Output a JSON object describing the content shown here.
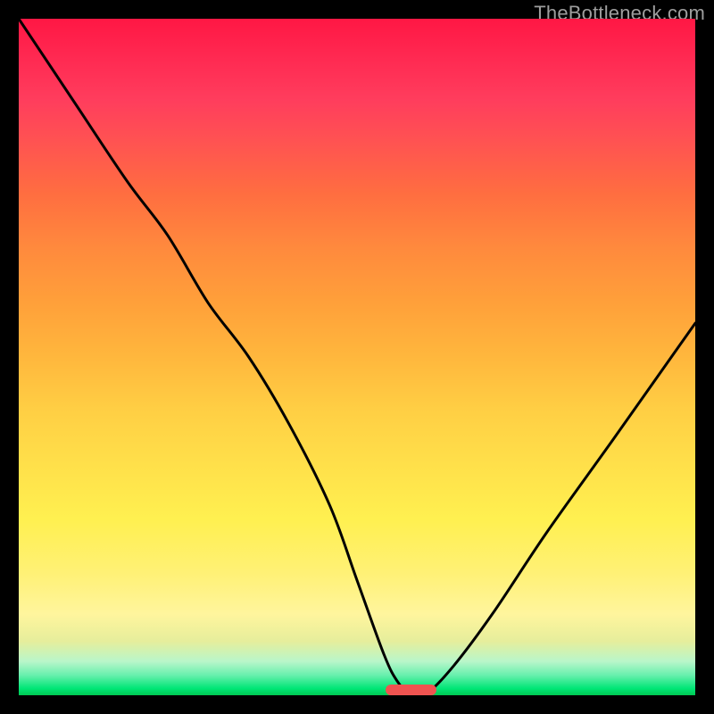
{
  "watermark": "TheBottleneck.com",
  "chart_data": {
    "type": "line",
    "title": "",
    "xlabel": "",
    "ylabel": "",
    "xlim": [
      0,
      100
    ],
    "ylim": [
      0,
      100
    ],
    "grid": false,
    "series": [
      {
        "name": "bottleneck-curve",
        "color": "#000000",
        "x": [
          0,
          8,
          16,
          22,
          28,
          34,
          40,
          46,
          50,
          54,
          56,
          58,
          60,
          64,
          70,
          78,
          88,
          100
        ],
        "values": [
          100,
          88,
          76,
          68,
          58,
          50,
          40,
          28,
          17,
          6,
          2,
          0,
          0,
          4,
          12,
          24,
          38,
          55
        ]
      }
    ],
    "gradient_stops": [
      {
        "pos": 0,
        "color": "#ff1744"
      },
      {
        "pos": 50,
        "color": "#ffb73d"
      },
      {
        "pos": 82,
        "color": "#fff176"
      },
      {
        "pos": 99,
        "color": "#00e676"
      },
      {
        "pos": 100,
        "color": "#00c853"
      }
    ],
    "marker": {
      "name": "optimum-marker",
      "color": "#ef5350",
      "x_center": 58,
      "y": 0,
      "width_pct": 7.5,
      "height_pct": 1.6
    }
  }
}
